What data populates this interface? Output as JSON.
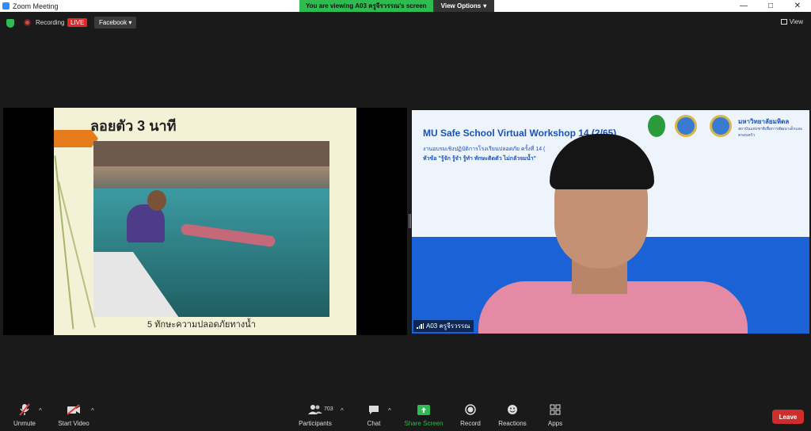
{
  "window": {
    "title": "Zoom Meeting"
  },
  "share_banner": {
    "message": "You are viewing A03 ครูจีรวรรณ's screen",
    "options_label": "View Options"
  },
  "topbar": {
    "recording_label": "Recording",
    "live_label": "LIVE",
    "stream_target": "Facebook",
    "view_label": "View"
  },
  "shared_screen": {
    "slide_title": "ลอยตัว 3 นาที",
    "slide_caption": "5 ทักษะความปลอดภัยทางน้ำ"
  },
  "video_tile": {
    "workshop_title": "MU Safe School Virtual Workshop 14 (2/65)",
    "workshop_line1": "งานอบรมเชิงปฏิบัติการโรงเรียนปลอดภัย ครั้งที่ 14 (",
    "workshop_line2": "หัวข้อ \"รู้จัก รู้จำ รู้ทำ ทักษะติดตัว ไม่กลัวจมน้ำ\"",
    "uni_name": "มหาวิทยาลัยมหิดล",
    "uni_sub": "สถาบันแห่งชาติเพื่อการพัฒนาเด็กและครอบครัว",
    "participant_name": "A03 ครูจีรวรรณ"
  },
  "toolbar": {
    "unmute": "Unmute",
    "start_video": "Start Video",
    "participants": "Participants",
    "participants_count": "703",
    "chat": "Chat",
    "share_screen": "Share Screen",
    "record": "Record",
    "reactions": "Reactions",
    "apps": "Apps",
    "leave": "Leave"
  },
  "colors": {
    "share_green": "#2ebb4f",
    "leave_red": "#cc2d2d",
    "live_red": "#e02828"
  },
  "icons": [
    "app-icon",
    "minimize-icon",
    "maximize-icon",
    "close-icon",
    "shield-icon",
    "record-dot-icon",
    "view-grid-icon",
    "mic-muted-icon",
    "video-off-icon",
    "participants-icon",
    "chat-icon",
    "share-screen-icon",
    "record-icon",
    "reactions-icon",
    "apps-icon"
  ]
}
